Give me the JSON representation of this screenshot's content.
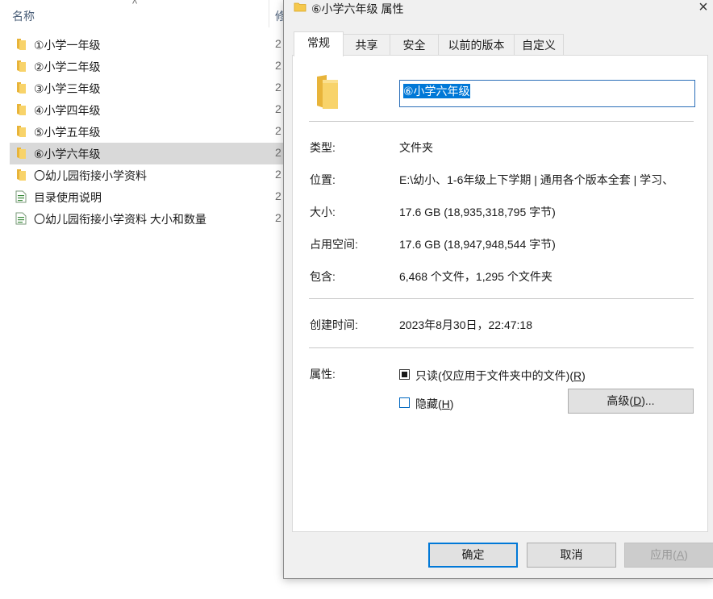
{
  "explorer": {
    "name_header": "名称",
    "modified_header": "修",
    "items": [
      {
        "name": "①小学一年级",
        "type": "folder",
        "mod": "2"
      },
      {
        "name": "②小学二年级",
        "type": "folder",
        "mod": "2"
      },
      {
        "name": "③小学三年级",
        "type": "folder",
        "mod": "2"
      },
      {
        "name": "④小学四年级",
        "type": "folder",
        "mod": "2"
      },
      {
        "name": "⑤小学五年级",
        "type": "folder",
        "mod": "2"
      },
      {
        "name": "⑥小学六年级",
        "type": "folder",
        "mod": "2",
        "selected": true
      },
      {
        "name": "〇幼儿园衔接小学资料",
        "type": "folder",
        "mod": "2"
      },
      {
        "name": "目录使用说明",
        "type": "file",
        "mod": "2"
      },
      {
        "name": "〇幼儿园衔接小学资料 大小和数量",
        "type": "file",
        "mod": "2"
      }
    ]
  },
  "dialog": {
    "title": "⑥小学六年级 属性",
    "close_icon": "×",
    "tabs": [
      "常规",
      "共享",
      "安全",
      "以前的版本",
      "自定义"
    ],
    "active_tab": "常规",
    "folder_name": "⑥小学六年级",
    "props": {
      "type_label": "类型:",
      "type_value": "文件夹",
      "location_label": "位置:",
      "location_value": "E:\\幼小、1-6年级上下学期 | 通用各个版本全套 | 学习、",
      "size_label": "大小:",
      "size_value": "17.6 GB (18,935,318,795 字节)",
      "disk_label": "占用空间:",
      "disk_value": "17.6 GB (18,947,948,544 字节)",
      "contains_label": "包含:",
      "contains_value": "6,468 个文件，1,295 个文件夹",
      "created_label": "创建时间:",
      "created_value": "2023年8月30日，22:47:18",
      "attr_label": "属性:"
    },
    "attributes": {
      "readonly_text": "只读(仅应用于文件夹中的文件)(",
      "readonly_key": "R",
      "readonly_tail": ")",
      "hidden_text": "隐藏(",
      "hidden_key": "H",
      "hidden_tail": ")",
      "advanced_text": "高级(",
      "advanced_key": "D",
      "advanced_tail": ")..."
    },
    "buttons": {
      "ok": "确定",
      "cancel": "取消",
      "apply_text": "应用(",
      "apply_key": "A",
      "apply_tail": ")"
    },
    "colors": {
      "folder": "#f5c84c",
      "selection": "#0078d7",
      "selected_row": "#d9d9d9"
    }
  }
}
